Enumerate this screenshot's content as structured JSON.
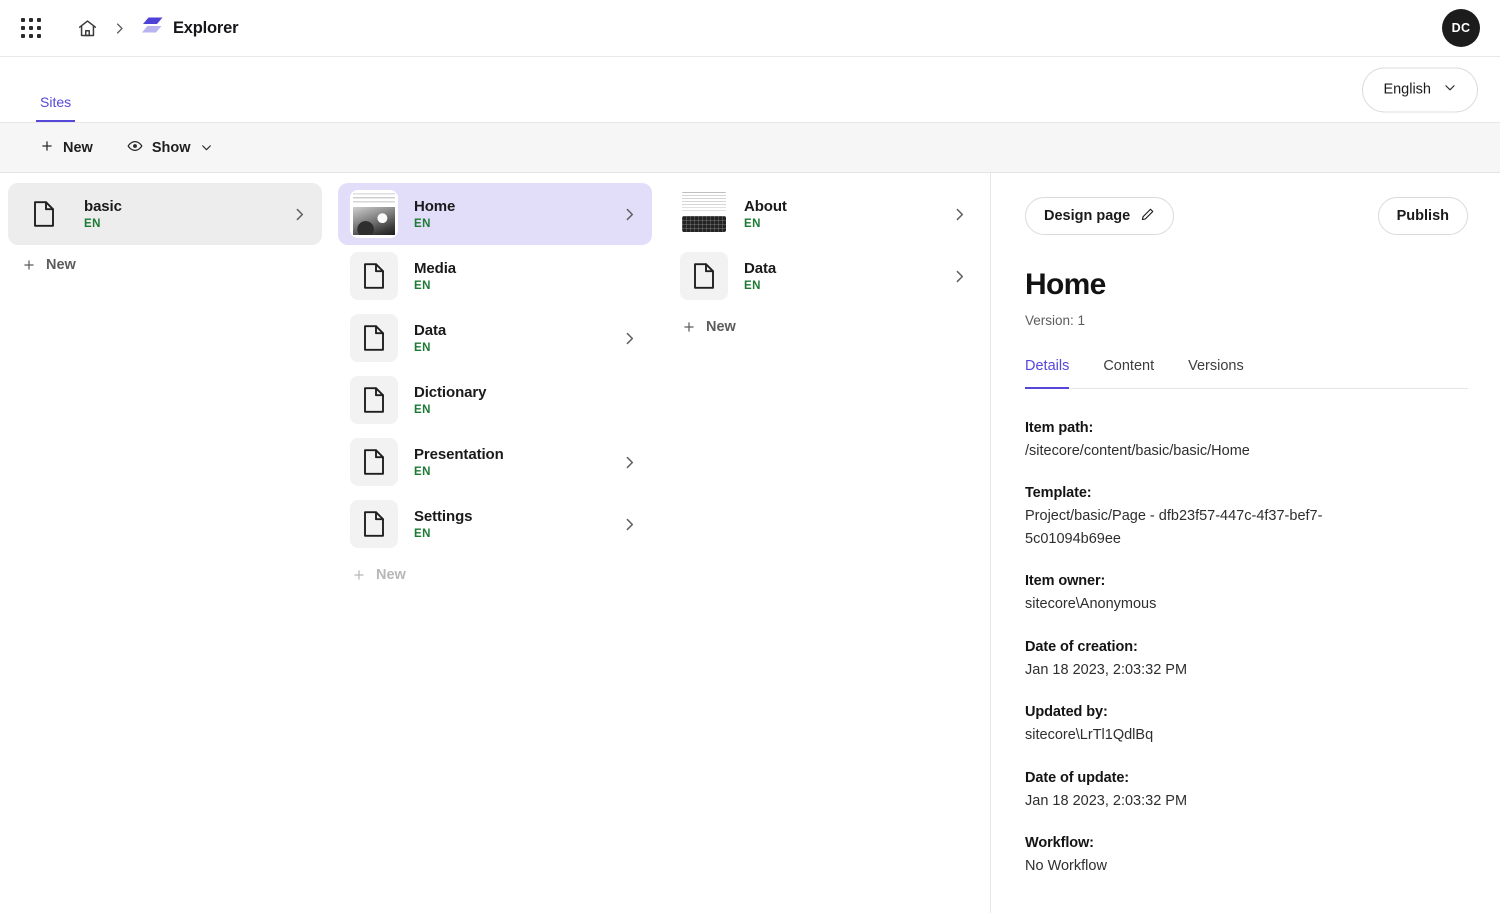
{
  "app": {
    "brand_name": "Explorer",
    "apps_icon": "apps-grid-icon",
    "home_icon": "home-icon",
    "breadcrumb_separator_icon": "chevron-right-icon",
    "brand_logo_icon": "sitecore-explorer-logo-icon",
    "avatar_initials": "DC",
    "accent_color": "#5548d9",
    "selection_color": "#e2defa",
    "language_badge_color": "#1c7a35"
  },
  "tabs": {
    "sites_label": "Sites"
  },
  "language_selector": {
    "value": "English",
    "caret_icon": "chevron-down-icon"
  },
  "toolbar": {
    "new_label": "New",
    "new_icon": "plus-icon",
    "show_label": "Show",
    "show_icon": "eye-icon",
    "show_caret_icon": "chevron-down-icon"
  },
  "columns": [
    {
      "name": "sites-column",
      "new_label": "New",
      "new_muted": false,
      "items": [
        {
          "label": "basic",
          "language": "EN",
          "icon": "document-icon",
          "icon_style": "bare",
          "selected": "gray",
          "has_chevron": true
        }
      ]
    },
    {
      "name": "site-children-column",
      "new_label": "New",
      "new_muted": true,
      "items": [
        {
          "label": "Home",
          "language": "EN",
          "icon": "page-thumbnail",
          "icon_style": "thumb-photo",
          "selected": "purple",
          "has_chevron": true
        },
        {
          "label": "Media",
          "language": "EN",
          "icon": "document-icon",
          "icon_style": "box",
          "selected": "none",
          "has_chevron": false
        },
        {
          "label": "Data",
          "language": "EN",
          "icon": "document-icon",
          "icon_style": "box",
          "selected": "none",
          "has_chevron": true
        },
        {
          "label": "Dictionary",
          "language": "EN",
          "icon": "document-icon",
          "icon_style": "box",
          "selected": "none",
          "has_chevron": false
        },
        {
          "label": "Presentation",
          "language": "EN",
          "icon": "document-icon",
          "icon_style": "box",
          "selected": "none",
          "has_chevron": true
        },
        {
          "label": "Settings",
          "language": "EN",
          "icon": "document-icon",
          "icon_style": "box",
          "selected": "none",
          "has_chevron": true
        }
      ]
    },
    {
      "name": "home-children-column",
      "new_label": "New",
      "new_muted": false,
      "items": [
        {
          "label": "About",
          "language": "EN",
          "icon": "page-thumbnail",
          "icon_style": "thumb-keyboard",
          "selected": "none",
          "has_chevron": true
        },
        {
          "label": "Data",
          "language": "EN",
          "icon": "document-icon",
          "icon_style": "box",
          "selected": "none",
          "has_chevron": true
        }
      ]
    }
  ],
  "detail": {
    "design_page_label": "Design page",
    "design_page_icon": "pencil-icon",
    "publish_label": "Publish",
    "title": "Home",
    "version": "Version: 1",
    "tabs": [
      {
        "label": "Details",
        "active": true
      },
      {
        "label": "Content",
        "active": false
      },
      {
        "label": "Versions",
        "active": false
      }
    ],
    "fields": [
      {
        "label": "Item path:",
        "value": "/sitecore/content/basic/basic/Home"
      },
      {
        "label": "Template:",
        "value": "Project/basic/Page - dfb23f57-447c-4f37-bef7-5c01094b69ee"
      },
      {
        "label": "Item owner:",
        "value": "sitecore\\Anonymous"
      },
      {
        "label": "Date of creation:",
        "value": "Jan 18 2023, 2:03:32 PM"
      },
      {
        "label": "Updated by:",
        "value": "sitecore\\LrTl1QdlBq"
      },
      {
        "label": "Date of update:",
        "value": "Jan 18 2023, 2:03:32 PM"
      },
      {
        "label": "Workflow:",
        "value": "No Workflow"
      }
    ]
  }
}
